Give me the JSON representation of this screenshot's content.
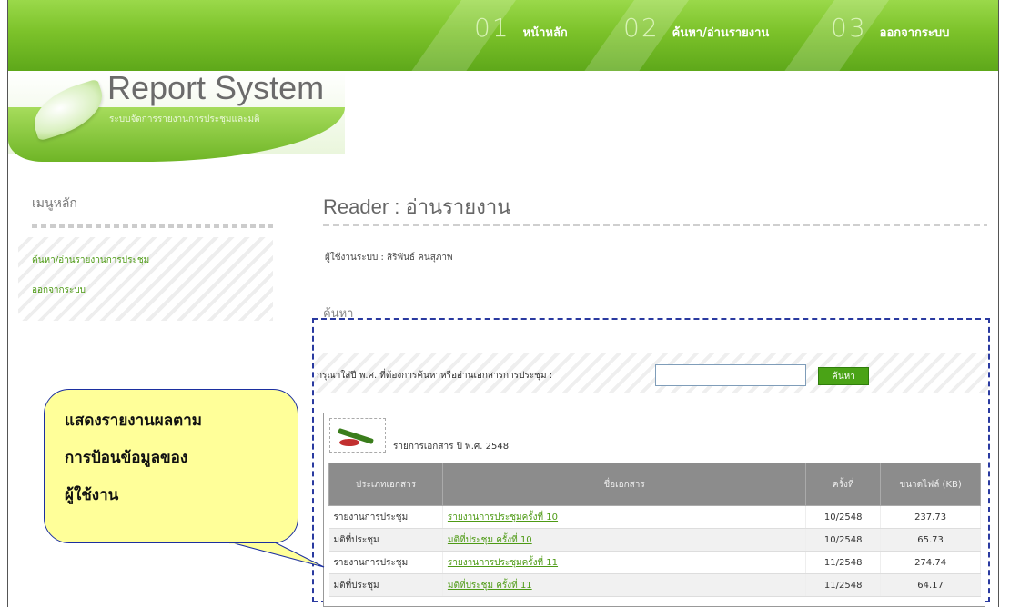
{
  "nav": [
    {
      "num": "01",
      "label": "หน้าหลัก"
    },
    {
      "num": "02",
      "label": "ค้นหา/อ่านรายงาน"
    },
    {
      "num": "03",
      "label": "ออกจากระบบ"
    }
  ],
  "logo": {
    "title": "Report System",
    "subtitle": "ระบบจัดการรายงานการประชุมและมติ"
  },
  "sidebar": {
    "title": "เมนูหลัก",
    "items": [
      {
        "label": "ค้นหา/อ่านรายงานการประชุม"
      },
      {
        "label": "ออกจากระบบ"
      }
    ]
  },
  "main": {
    "title": "Reader : อ่านรายงาน",
    "user_line": "ผู้ใช้งานระบบ : สิริพันธ์ คนสุภาพ",
    "search_heading": "ค้นหา",
    "search_label": "กรุณาใส่ปี พ.ศ. ที่ต้องการค้นหาหรืออ่านเอกสารการประชุม :",
    "search_value": "",
    "search_button": "ค้นหา"
  },
  "table": {
    "caption": "รายการเอกสาร ปี พ.ศ. 2548",
    "headers": [
      "ประเภทเอกสาร",
      "ชื่อเอกสาร",
      "ครั้งที่",
      "ขนาดไฟล์ (KB)"
    ],
    "rows": [
      {
        "type": "รายงานการประชุม",
        "name": "รายงานการประชุมครั้งที่ 10",
        "session": "10/2548",
        "size": "237.73"
      },
      {
        "type": "มติที่ประชุม",
        "name": "มติที่ประชุม ครั้งที่ 10",
        "session": "10/2548",
        "size": "65.73"
      },
      {
        "type": "รายงานการประชุม",
        "name": "รายงานการประชุมครั้งที่ 11",
        "session": "11/2548",
        "size": "274.74"
      },
      {
        "type": "มติที่ประชุม",
        "name": "มติที่ประชุม ครั้งที่ 11",
        "session": "11/2548",
        "size": "64.17"
      }
    ]
  },
  "callout": {
    "lines": [
      "แสดงรายงานผลตาม",
      "การป้อนข้อมูลของ",
      "ผู้ใช้งาน"
    ]
  },
  "colors": {
    "brand_green": "#6fb526",
    "link_green": "#4d9a14",
    "callout_yellow": "#ffff99",
    "callout_border": "#1c2fa0"
  }
}
